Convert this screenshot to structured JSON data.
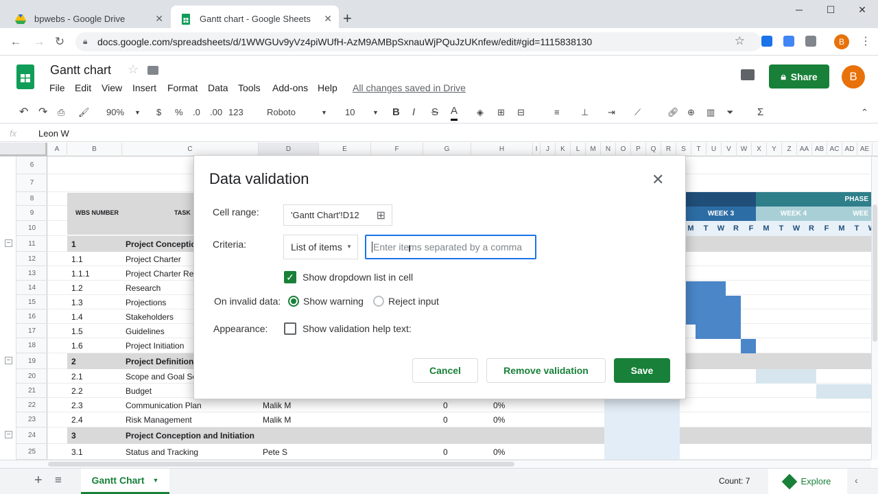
{
  "browser": {
    "tabs": [
      {
        "label": "bpwebs - Google Drive",
        "icon": "google-drive-icon"
      },
      {
        "label": "Gantt chart - Google Sheets",
        "icon": "google-sheets-icon"
      }
    ],
    "url": "docs.google.com/spreadsheets/d/1WWGUv9yVz4piWUfH-AzM9AMBpSxnauWjPQuJzUKnfew/edit#gid=1115838130",
    "profile_initial": "B"
  },
  "doc": {
    "title": "Gantt chart",
    "menu": [
      "File",
      "Edit",
      "View",
      "Insert",
      "Format",
      "Data",
      "Tools",
      "Add-ons",
      "Help"
    ],
    "saved_status": "All changes saved in Drive",
    "share_label": "Share",
    "avatar_initial": "B"
  },
  "toolbar": {
    "zoom": "90%",
    "currency": "$",
    "percent": "%",
    "dec_decrease": ".0",
    "dec_increase": ".00",
    "format_more": "123",
    "font": "Roboto",
    "font_size": "10",
    "bold": "B",
    "italic": "I",
    "strike": "S",
    "text_color": "A"
  },
  "formula_bar": {
    "fx": "fx",
    "value": "Leon W"
  },
  "grid": {
    "columns": [
      "A",
      "B",
      "C",
      "D",
      "E",
      "F",
      "G",
      "H",
      "I",
      "J",
      "K",
      "L",
      "M",
      "N",
      "O",
      "P",
      "Q",
      "R",
      "S",
      "T",
      "U",
      "V",
      "W",
      "X",
      "Y",
      "Z",
      "AA",
      "AB",
      "AC",
      "AD",
      "AE"
    ],
    "row_numbers": [
      "6",
      "7",
      "8",
      "9",
      "10",
      "11",
      "12",
      "13",
      "14",
      "15",
      "16",
      "17",
      "18",
      "19",
      "20",
      "21",
      "22",
      "23",
      "24",
      "25"
    ],
    "header_wbs": "WBS NUMBER",
    "header_task": "TASK",
    "rows": [
      {
        "row": "11",
        "wbs": "1",
        "task": "Project Conception",
        "band": true
      },
      {
        "row": "12",
        "wbs": "1.1",
        "task": "Project Charter"
      },
      {
        "row": "13",
        "wbs": "1.1.1",
        "task": "Project Charter Rev"
      },
      {
        "row": "14",
        "wbs": "1.2",
        "task": "Research"
      },
      {
        "row": "15",
        "wbs": "1.3",
        "task": "Projections"
      },
      {
        "row": "16",
        "wbs": "1.4",
        "task": "Stakeholders"
      },
      {
        "row": "17",
        "wbs": "1.5",
        "task": "Guidelines"
      },
      {
        "row": "18",
        "wbs": "1.6",
        "task": "Project Initiation"
      },
      {
        "row": "19",
        "wbs": "2",
        "task": "Project Definition",
        "band": true
      },
      {
        "row": "20",
        "wbs": "2.1",
        "task": "Scope and Goal Se"
      },
      {
        "row": "21",
        "wbs": "2.2",
        "task": "Budget"
      },
      {
        "row": "22",
        "wbs": "2.3",
        "task": "Communication Plan",
        "owner": "Malik M",
        "days": "0",
        "pct": "0%"
      },
      {
        "row": "23",
        "wbs": "2.4",
        "task": "Risk Management",
        "owner": "Malik M",
        "days": "0",
        "pct": "0%"
      },
      {
        "row": "24",
        "wbs": "3",
        "task": "Project Conception and Initiation",
        "band": true
      },
      {
        "row": "25",
        "wbs": "3.1",
        "task": "Status and Tracking",
        "owner": "Pete S",
        "days": "0",
        "pct": "0%"
      }
    ],
    "gantt": {
      "phase_label": "PHASE",
      "week3": "WEEK 3",
      "week4": "WEEK 4",
      "week5": "WEE",
      "days": [
        "M",
        "T",
        "W",
        "R",
        "F",
        "M",
        "T",
        "W",
        "R",
        "F",
        "M",
        "T",
        "W"
      ]
    }
  },
  "dialog": {
    "title": "Data validation",
    "cell_range_label": "Cell range:",
    "cell_range_value": "'Gantt Chart'!D12",
    "criteria_label": "Criteria:",
    "criteria_value": "List of items",
    "items_placeholder": "Enter items separated by a comma",
    "show_dropdown_label": "Show dropdown list in cell",
    "show_dropdown_checked": true,
    "invalid_label": "On invalid data:",
    "show_warning": "Show warning",
    "reject_input": "Reject input",
    "appearance_label": "Appearance:",
    "help_text_label": "Show validation help text:",
    "cancel": "Cancel",
    "remove": "Remove validation",
    "save": "Save"
  },
  "bottom": {
    "sheet_tab": "Gantt Chart",
    "count": "Count: 7",
    "explore": "Explore"
  }
}
